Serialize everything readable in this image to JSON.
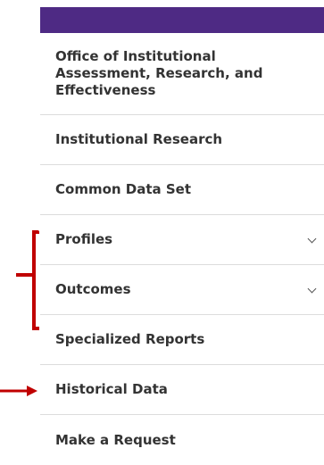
{
  "nav": {
    "items": [
      {
        "label": "Office of Institutional Assessment, Research, and Effectiveness",
        "expandable": false
      },
      {
        "label": "Institutional Research",
        "expandable": false
      },
      {
        "label": "Common Data Set",
        "expandable": false
      },
      {
        "label": "Profiles",
        "expandable": true
      },
      {
        "label": "Outcomes",
        "expandable": true
      },
      {
        "label": "Specialized Reports",
        "expandable": false
      },
      {
        "label": "Historical Data",
        "expandable": false
      },
      {
        "label": "Make a Request",
        "expandable": false
      }
    ]
  },
  "colors": {
    "header_bar": "#4e2a84",
    "annotation": "#c00000",
    "divider": "#dcdcdc"
  }
}
